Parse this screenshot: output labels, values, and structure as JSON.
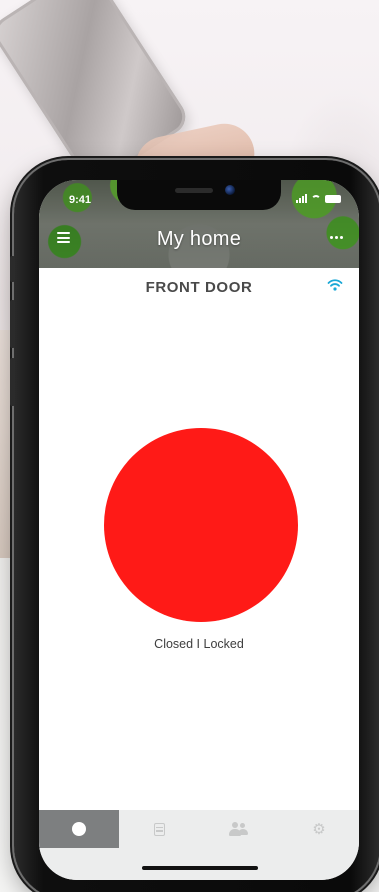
{
  "status_bar": {
    "time": "9:41"
  },
  "header": {
    "title": "My home",
    "menu_icon": "hamburger-menu-icon",
    "more_icon": "more-dots-icon"
  },
  "device": {
    "name": "FRONT DOOR",
    "connection_icon": "wifi-icon",
    "status_text": "Closed I Locked",
    "lock_color": "#ff1a17"
  },
  "tabbar": {
    "tabs": [
      {
        "icon": "dot-icon",
        "active": true
      },
      {
        "icon": "list-icon",
        "active": false
      },
      {
        "icon": "users-icon",
        "active": false
      },
      {
        "icon": "gear-icon",
        "active": false
      }
    ],
    "active_color": "#7d7f80"
  },
  "colors": {
    "accent_wifi": "#1aa8d6",
    "title_text": "#4a4a4a"
  }
}
